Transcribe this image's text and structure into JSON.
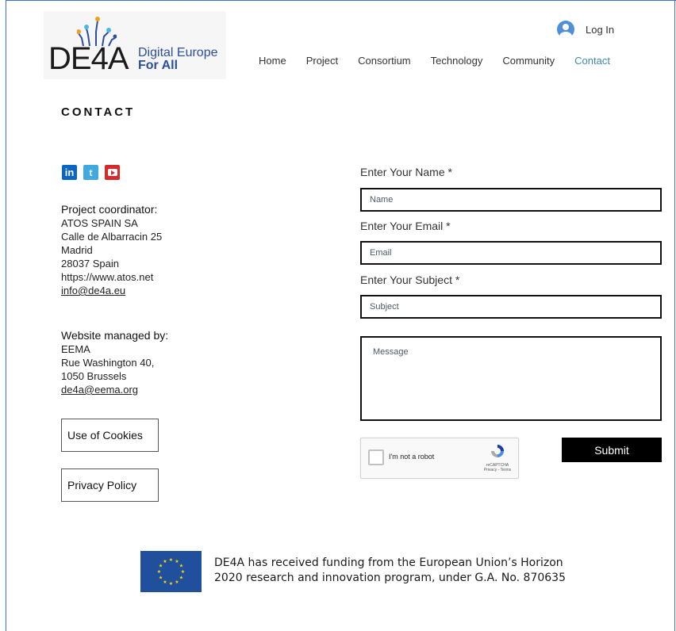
{
  "header": {
    "logo": {
      "mark": "DE4A",
      "line1": "Digital Europe",
      "line2": "For All"
    },
    "login_label": "Log In",
    "nav": [
      {
        "label": "Home"
      },
      {
        "label": "Project"
      },
      {
        "label": "Consortium"
      },
      {
        "label": "Technology"
      },
      {
        "label": "Community"
      },
      {
        "label": "Contact",
        "active": true
      }
    ]
  },
  "page": {
    "title": "CONTACT"
  },
  "social": [
    {
      "icon": "linkedin-icon",
      "glyph": "in",
      "color": "#0a66c2"
    },
    {
      "icon": "twitter-icon",
      "glyph": "t",
      "color": "#3fa9e0"
    },
    {
      "icon": "youtube-icon",
      "glyph": "",
      "color": "#d42c2c"
    }
  ],
  "coordinator": {
    "heading": "Project coordinator:",
    "name": "ATOS SPAIN SA",
    "street": "Calle de Albarracin 25",
    "city": "Madrid",
    "postal": "28037 Spain",
    "website": "https://www.atos.net",
    "email": "info@de4a.eu"
  },
  "manager": {
    "heading": "Website managed by:",
    "name": "EEMA",
    "street": "Rue Washington 40,",
    "postal": "1050 Brussels",
    "email": "de4a@eema.org"
  },
  "buttons": {
    "cookies": "Use of Cookies",
    "privacy": "Privacy Policy"
  },
  "form": {
    "name_label": "Enter Your Name *",
    "name_placeholder": "Name",
    "email_label": "Enter Your Email *",
    "email_placeholder": "Email",
    "subject_label": "Enter Your Subject *",
    "subject_placeholder": "Subject",
    "message_placeholder": "Message",
    "captcha_label": "I'm not a robot",
    "captcha_brand": "reCAPTCHA",
    "captcha_links": "Privacy - Terms",
    "submit_label": "Submit"
  },
  "footer": {
    "line1": "DE4A has received funding from the European Union’s Horizon",
    "line2": "2020 research and innovation program, under G.A. No. 870635"
  },
  "colors": {
    "accent": "#3f88a8",
    "logo_blue": "#2a4ea0",
    "eu_blue": "#1f4f9d",
    "eu_star": "#ffdd00",
    "frame": "#3b6fd0"
  }
}
